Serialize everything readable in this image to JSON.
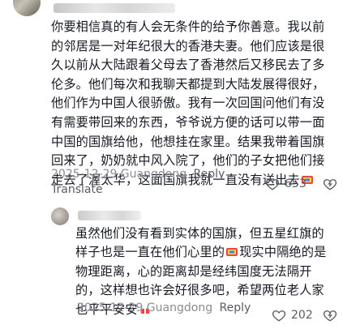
{
  "comments": [
    {
      "text_before_emoji": "你要相信真的有人会无条件的给予你善意。我以前的邻居是一对年纪很大的香港夫妻。他们应该是很久以前从大陆跟着父母去了香港然后又移民去了多伦多。他们每次和我聊天都提到大陆发展得很好，他们作为中国人很骄傲。我有一次回国问他们有没有需要带回来的东西，爷爷说方便的话可以带一面中国的国旗给他，他想挂在家里。结果我带着国旗回来了，奶奶就中风入院了，他们的子女把他们接走去了渥太华，这面国旗我就一直没有送出去",
      "text_after_emoji": "",
      "emoji": "flag-emoji",
      "date": "2025-12-29 Guangdong",
      "reply_label": "Reply",
      "translate_label": "Translate",
      "likes": "653"
    },
    {
      "text_before_emoji": "虽然他们没有看到实体的国旗，但五星红旗的样子也是一直在他们心里的",
      "text_after_emoji": "现实中隔绝的是物理距离，心的距离却是经纬国度无法隔开的，这样想也许会好很多吧，希望两位老人家也平平安安",
      "emoji": "flag-emoji",
      "end_emoji": "hands-emoji",
      "date": "2025-12-29 Guangdong",
      "reply_label": "Reply",
      "likes": "202"
    }
  ],
  "colors": {
    "text": "#161823",
    "meta": "#8a8b91",
    "action": "#5a5b63"
  }
}
